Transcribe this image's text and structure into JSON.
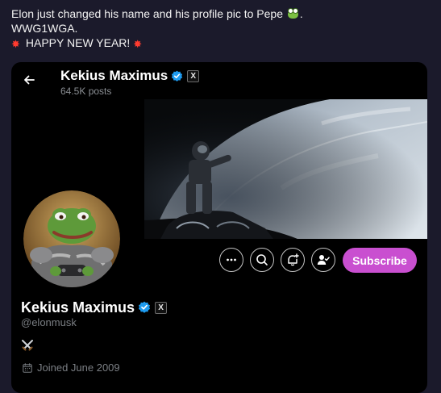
{
  "post": {
    "line1": "Elon just changed his name and his profile pic to Pepe",
    "line1_end": ".",
    "line2": "WWG1WGA.",
    "line3": "HAPPY NEW YEAR!"
  },
  "profile_header": {
    "name": "Kekius Maximus",
    "posts_count": "64.5K posts",
    "x_badge": "X"
  },
  "profile": {
    "name": "Kekius Maximus",
    "handle": "@elonmusk",
    "x_badge": "X",
    "joined": "Joined June 2009",
    "bio_icon": "crossed-swords-icon"
  },
  "actions": {
    "subscribe_label": "Subscribe",
    "icons": [
      "more-icon",
      "search-icon",
      "notification-add-icon",
      "follow-check-icon"
    ]
  },
  "colors": {
    "background": "#1b1a2b",
    "card": "#000000",
    "subscribe": "#c94fd0",
    "verified": "#1d9bf0",
    "muted_text": "#7b7f84"
  }
}
